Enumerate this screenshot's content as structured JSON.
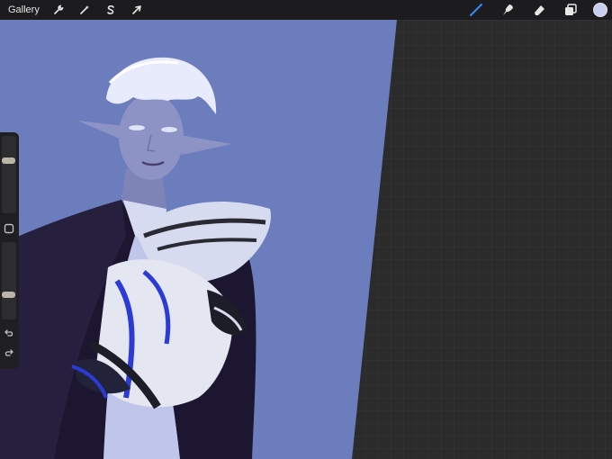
{
  "toolbar": {
    "gallery_label": "Gallery",
    "left_tools": [
      "wrench-icon",
      "magic-wand-icon",
      "selection-s-icon",
      "move-arrow-icon"
    ],
    "right_tools": [
      "brush-icon",
      "smudge-icon",
      "eraser-icon",
      "layers-icon"
    ],
    "active_tool": "brush-icon",
    "accent_color": "#2f8cff",
    "current_color": "#c7cef0"
  },
  "sidebar": {
    "brush_size_level": 0.7,
    "opacity_level": 0.3,
    "buttons": [
      "modifier-square-icon",
      "undo-icon",
      "redo-icon"
    ]
  },
  "canvas": {
    "background_color": "#6b7dbc",
    "empty_area_color": "#2b2b2b"
  }
}
